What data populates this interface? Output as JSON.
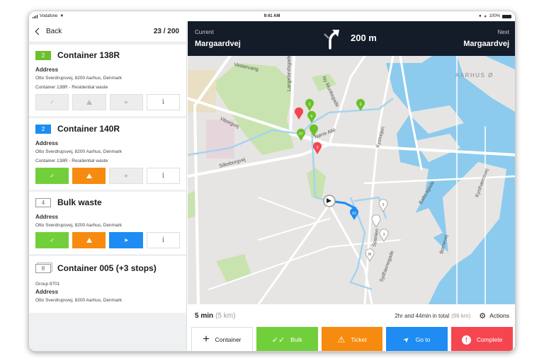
{
  "status_bar": {
    "carrier": "Vodafone",
    "time": "9:41 AM",
    "battery": "100%"
  },
  "sidebar": {
    "back_label": "Back",
    "counter": "23 / 200",
    "cards": [
      {
        "badge": "2",
        "badge_style": "green",
        "title": "Container 138R",
        "address_label": "Address",
        "address": "Otto Sverdrupsvej, 8200 Aarhus, Denmark",
        "description": "Container 138R - Residential waste",
        "actions_state": "disabled"
      },
      {
        "badge": "2",
        "badge_style": "blue",
        "title": "Container 140R",
        "address_label": "Address",
        "address": "Otto Sverdrupsvej, 8200 Aarhus, Denmark",
        "description": "Container 138R - Residential waste",
        "actions_state": "partial"
      },
      {
        "badge": "4",
        "badge_style": "outline",
        "title": "Bulk waste",
        "address_label": "Address",
        "address": "Otto Sverdrupsvej, 8200 Aarhus, Denmark",
        "actions_state": "active"
      },
      {
        "badge": "8",
        "badge_style": "stack",
        "title": "Container 005 (+3 stops)",
        "group": "Group 8701",
        "address_label": "Address",
        "address": "Otto Sverdrupsvej, 8200 Aarhus, Denmark"
      }
    ],
    "info_glyph": "i"
  },
  "navigation": {
    "current_label": "Current",
    "current_street": "Margaardvej",
    "turn_icon": "turn-right-icon",
    "distance": "200 m",
    "next_label": "Next",
    "next_street": "Margaardvej"
  },
  "map": {
    "district_label": "AARHUS Ø",
    "street_labels": [
      "Vestervang",
      "Langelandsgade",
      "Ny Munkegade",
      "Nørre Allé",
      "Viborgvej",
      "Silkeborgvej",
      "Kystvejen",
      "Balticagade",
      "Kysthærnsvej",
      "Bornevej",
      "Spanien",
      "Sydhavnegade"
    ],
    "markers": [
      {
        "label": "3",
        "color": "#6cc02a"
      },
      {
        "label": "6",
        "color": "#6cc02a"
      },
      {
        "label": "07",
        "color": "#6cc02a"
      },
      {
        "label": "",
        "color": "#6cc02a"
      },
      {
        "label": "6",
        "color": "#6cc02a"
      },
      {
        "label": "",
        "color": "#f5464f"
      },
      {
        "label": "3",
        "color": "#f5464f"
      },
      {
        "label": "63",
        "color": "#1e8cf2"
      },
      {
        "label": "3",
        "color": "#ffffff"
      },
      {
        "label": "",
        "color": "#ffffff"
      },
      {
        "label": "3",
        "color": "#ffffff"
      },
      {
        "label": "W",
        "color": "#ffffff"
      }
    ]
  },
  "route_summary": {
    "eta": "5 min",
    "eta_distance": "(5 km)",
    "total": "2hr and 44min in total",
    "total_distance": "(96 km)",
    "actions_label": "Actions"
  },
  "bottom_buttons": {
    "container": "Container",
    "bulk": "Bulk",
    "ticket": "Ticket",
    "goto": "Go to",
    "complete": "Complete"
  },
  "colors": {
    "green": "#72cf3c",
    "orange": "#f68b0f",
    "blue": "#1e8cf2",
    "red": "#f5464f",
    "navbar": "#141c29",
    "water": "#8ccbee"
  }
}
